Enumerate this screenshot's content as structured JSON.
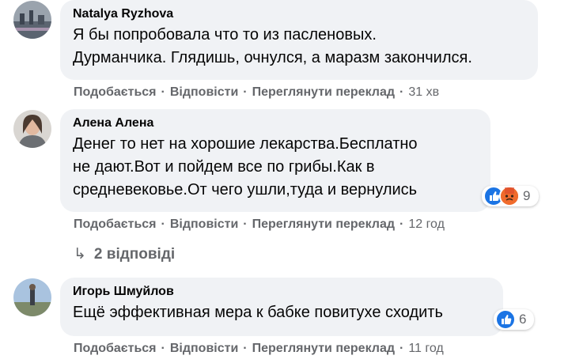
{
  "comments": [
    {
      "author": "Natalya Ryzhova",
      "text": "Я бы попробовала что то из пасленовых.\nДурманчика. Глядишь, очнулся, а маразм закончился.",
      "actions": {
        "like": "Подобається",
        "reply": "Відповісти",
        "translate": "Переглянути переклад",
        "time": "31 хв"
      }
    },
    {
      "author": "Алена Алена",
      "text": "Денег то нет на хорошие лекарства.Бесплатно\nне дают.Вот и пойдем все по грибы.Как в\nсредневековье.От чего ушли,туда и вернулись",
      "actions": {
        "like": "Подобається",
        "reply": "Відповісти",
        "translate": "Переглянути переклад",
        "time": "12 год"
      },
      "reactions": {
        "icons": [
          "like-icon",
          "angry-icon"
        ],
        "count": "9"
      }
    },
    {
      "author": "Игорь Шмуйлов",
      "text": "Ещё эффективная мера к бабке повитухе сходить",
      "actions": {
        "like": "Подобається",
        "reply": "Відповісти",
        "translate": "Переглянути переклад",
        "time": "11 год"
      },
      "reactions": {
        "icons": [
          "like-icon"
        ],
        "count": "6"
      }
    }
  ],
  "replies_link": {
    "label": "2 відповіді"
  },
  "separator": "·",
  "colors": {
    "bubble": "#f0f2f5",
    "meta": "#65676b",
    "like": "#1b74e4",
    "angry": "#f06b2c"
  }
}
